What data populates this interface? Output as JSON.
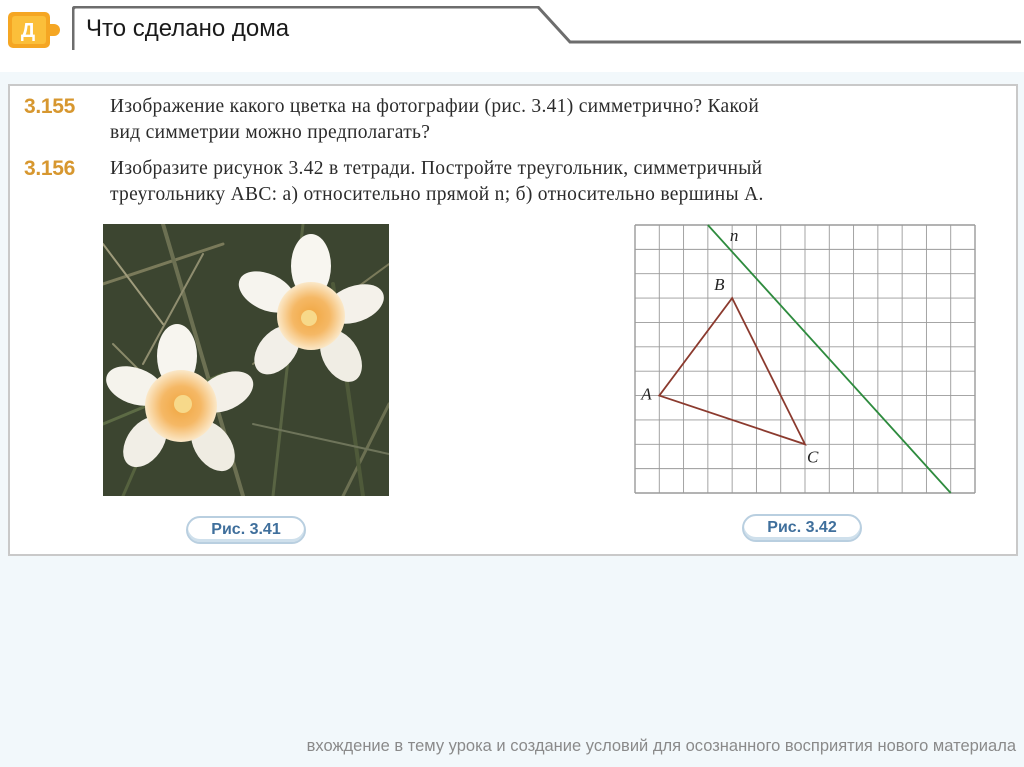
{
  "header": {
    "badge_letter": "Д",
    "title": "Что сделано дома",
    "accent_color": "#f5a623"
  },
  "problems": [
    {
      "number": "3.155",
      "lines": [
        "Изображение какого цветка на фотографии (рис. 3.41) симметрично? Какой",
        "вид симметрии можно предполагать?"
      ]
    },
    {
      "number": "3.156",
      "lines": [
        "Изобразите рисунок 3.42 в тетради. Постройте треугольник, симметричный",
        "треугольнику ABC: а) относительно прямой n; б) относительно вершины A."
      ]
    }
  ],
  "figures": {
    "photo_caption": "Рис. 3.41",
    "grid_caption": "Рис. 3.42",
    "grid": {
      "columns": 14,
      "rows": 11,
      "line_label": "n",
      "vertices": [
        {
          "label": "A",
          "col": 1,
          "row": 7
        },
        {
          "label": "B",
          "col": 4,
          "row": 3
        },
        {
          "label": "C",
          "col": 7,
          "row": 9
        }
      ],
      "line_n": {
        "from": [
          3,
          0
        ],
        "to": [
          13,
          11
        ]
      },
      "triangle_color": "#8b3a2e",
      "line_color": "#2e8b3e"
    }
  },
  "footer": "вхождение в тему урока и создание условий для осознанного восприятия нового материала"
}
